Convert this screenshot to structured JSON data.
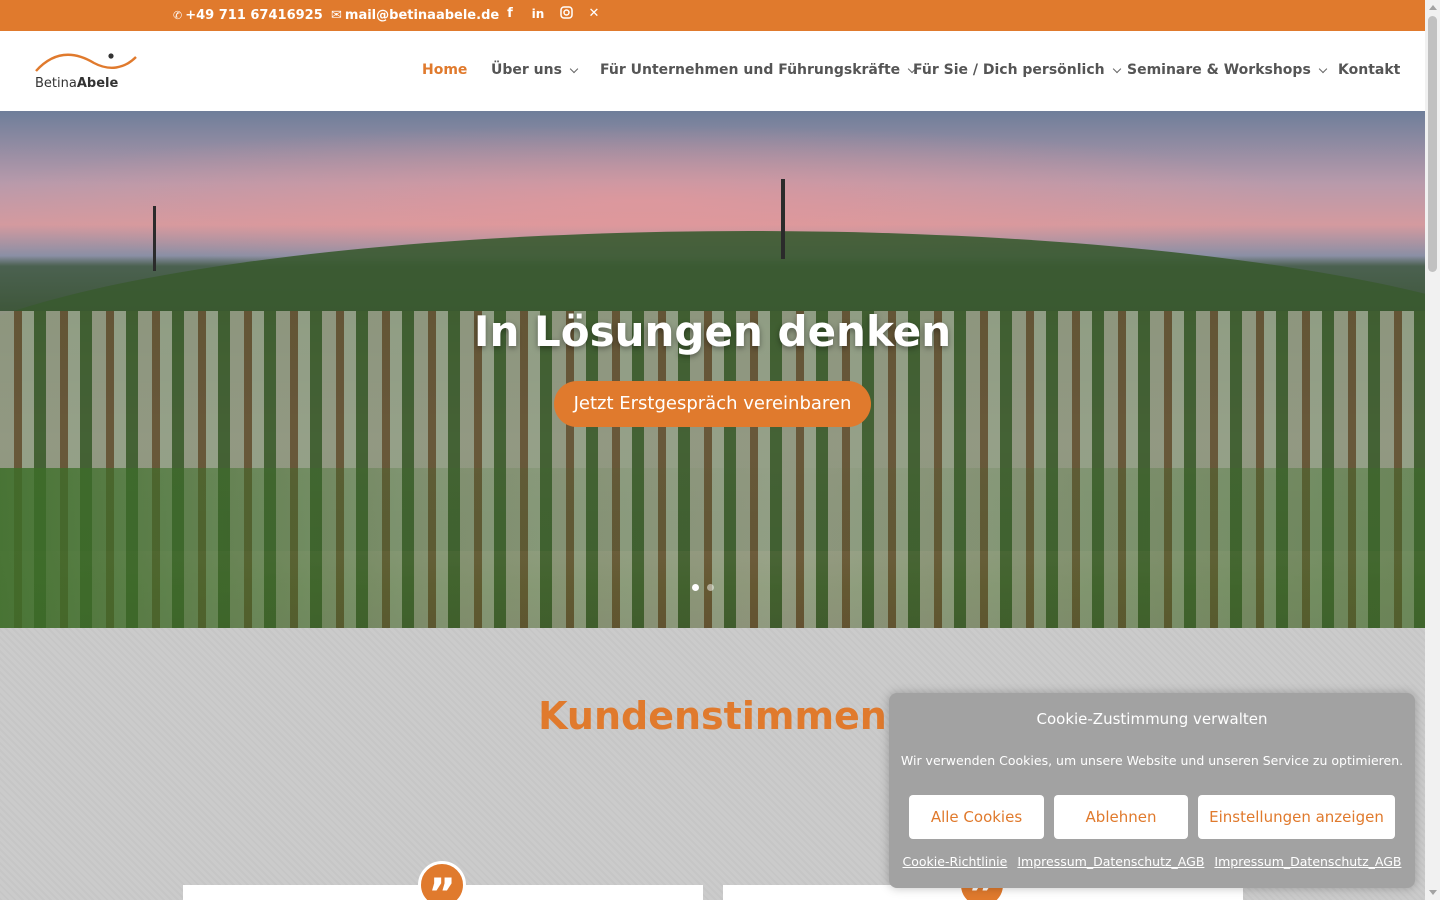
{
  "topbar": {
    "phone": "+49 711 67416925",
    "email": "mail@betinaabele.de",
    "social": [
      "facebook-icon",
      "linkedin-icon",
      "instagram-icon",
      "xing-icon"
    ]
  },
  "logo": {
    "first": "Betina",
    "last": "Abele"
  },
  "nav": {
    "items": [
      {
        "label": "Home",
        "active": true,
        "dropdown": false
      },
      {
        "label": "Über uns",
        "active": false,
        "dropdown": true
      },
      {
        "label": "Für Unternehmen und Führungskräfte",
        "active": false,
        "dropdown": true
      },
      {
        "label": "Für Sie / Dich persönlich",
        "active": false,
        "dropdown": true
      },
      {
        "label": "Seminare & Workshops",
        "active": false,
        "dropdown": true
      },
      {
        "label": "Kontakt",
        "active": false,
        "dropdown": false
      }
    ]
  },
  "hero": {
    "title": "In Lösungen denken",
    "cta": "Jetzt Erstgespräch vereinbaren",
    "slide_count": 2,
    "active_slide": 1
  },
  "testimonials": {
    "title": "Kundenstimmen"
  },
  "cookie": {
    "title": "Cookie-Zustimmung verwalten",
    "text": "Wir verwenden Cookies, um unsere Website und unseren Service zu optimieren.",
    "accept_label": "Alle Cookies",
    "deny_label": "Ablehnen",
    "settings_label": "Einstellungen anzeigen",
    "links": [
      "Cookie-Richtlinie",
      "Impressum_Datenschutz_AGB",
      "Impressum_Datenschutz_AGB"
    ]
  },
  "colors": {
    "accent": "#e07a2d",
    "nav_text": "#555555",
    "section_bg": "#c9c9c9",
    "cookie_bg": "#a2a2a2"
  }
}
